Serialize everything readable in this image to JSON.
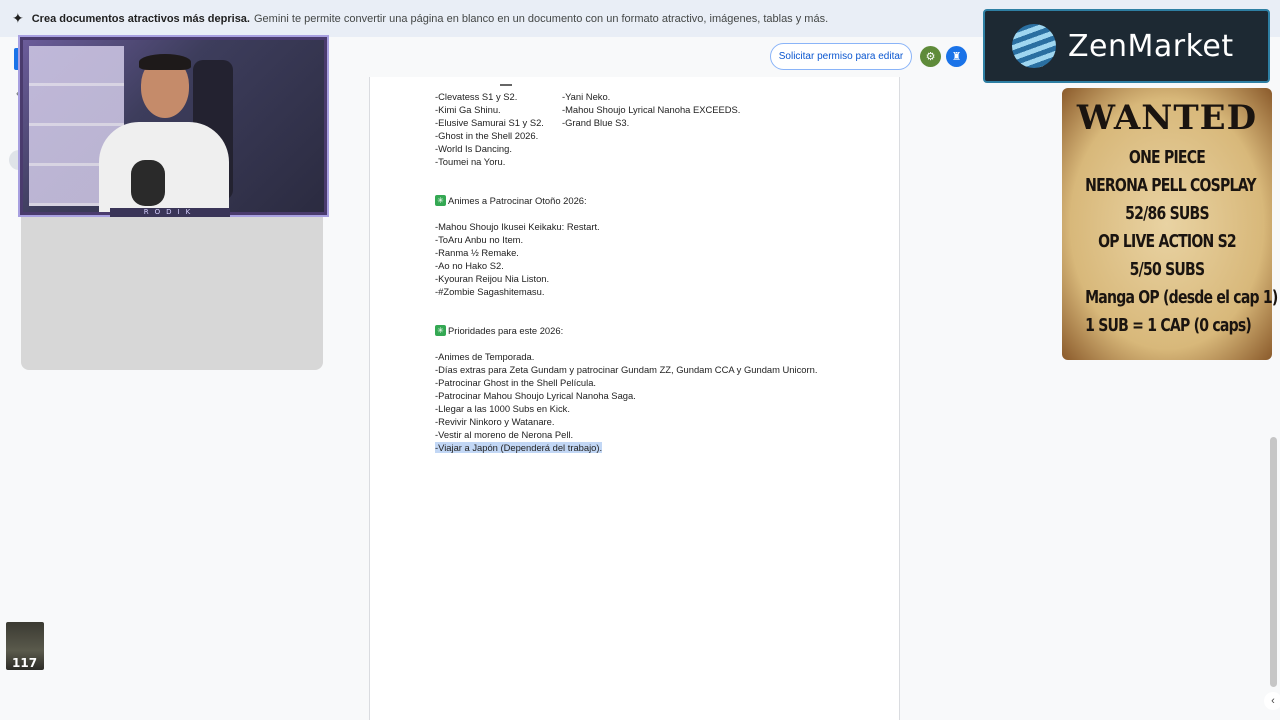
{
  "banner": {
    "bold_text": "Crea documentos atractivos más deprisa.",
    "text": "Gemini te permite convertir una página en blanco en un documento con un formato atractivo, imágenes, tablas y más."
  },
  "toolbar": {
    "request_edit_label": "Solicitar permiso para editar"
  },
  "document": {
    "col_rows": [
      {
        "left": "-Clevatess S1 y S2.",
        "right": "-Yani Neko."
      },
      {
        "left": "-Kimi Ga Shinu.",
        "right": "-Mahou Shoujo Lyrical Nanoha EXCEEDS."
      },
      {
        "left": "-Elusive Samurai S1 y S2.",
        "right": "-Grand Blue S3."
      }
    ],
    "list1_rest": [
      "-Ghost in the Shell 2026.",
      "-World Is Dancing.",
      "-Toumei na Yoru."
    ],
    "heading_autumn": "Animes a Patrocinar Otoño 2026:",
    "autumn_items": [
      "-Mahou Shoujo Ikusei Keikaku: Restart.",
      "-ToAru Anbu no Item.",
      "-Ranma ½ Remake.",
      "-Ao no Hako S2.",
      "-Kyouran Reijou Nia Liston.",
      "-#Zombie Sagashitemasu."
    ],
    "heading_priorities": "Prioridades para este 2026:",
    "priority_items": [
      "-Animes de Temporada.",
      "-Días extras para Zeta Gundam y patrocinar Gundam ZZ, Gundam CCA y Gundam Unicorn.",
      "-Patrocinar Ghost in the Shell Película.",
      "-Patrocinar Mahou Shoujo Lyrical Nanoha Saga.",
      "-Llegar a las 1000 Subs en Kick.",
      "-Revivir Ninkoro y Watanare.",
      "-Vestir al moreno de Nerona Pell."
    ],
    "selected_item": "-Viajar a Japón (Dependerá del trabajo)."
  },
  "webcam": {
    "label": "RODIK"
  },
  "sponsor": {
    "brand": "ZenMarket"
  },
  "wanted": {
    "title": "WANTED",
    "lines": [
      "ONE PIECE",
      "NERONA PELL COSPLAY",
      "52/86 SUBS",
      "OP LIVE ACTION S2",
      "5/50 SUBS",
      "Manga OP (desde el cap 1)",
      "1 SUB = 1 CAP (0 caps)"
    ]
  },
  "small_avatar": {
    "label": "117"
  },
  "colors": {
    "banner_bg": "#e9eef6",
    "accent_blue": "#0b57d0",
    "selection": "#c2d7f5",
    "check_green": "#34a853"
  }
}
